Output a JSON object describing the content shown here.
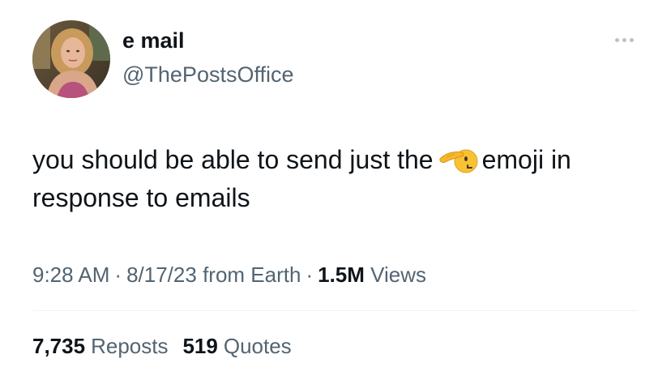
{
  "author": {
    "display_name": "e mail",
    "handle": "@ThePostsOffice",
    "avatar_icon": "profile-photo"
  },
  "more_icon": "more-horizontal-icon",
  "tweet": {
    "text_line1_before": "you should be able to send just the",
    "emoji_icon": "saluting-face-emoji",
    "text_line1_after": "emoji in",
    "text_line2": "response to emails"
  },
  "meta": {
    "time": "9:28 AM",
    "separator": "·",
    "date": "8/17/23",
    "source": "from Earth",
    "views_count": "1.5M",
    "views_label": "Views"
  },
  "stats": {
    "reposts_count": "7,735",
    "reposts_label": "Reposts",
    "quotes_count": "519",
    "quotes_label": "Quotes"
  },
  "colors": {
    "text_primary": "#0f1419",
    "text_secondary": "#536471",
    "divider": "#eff3f4",
    "emoji_yellow": "#f7c234"
  }
}
